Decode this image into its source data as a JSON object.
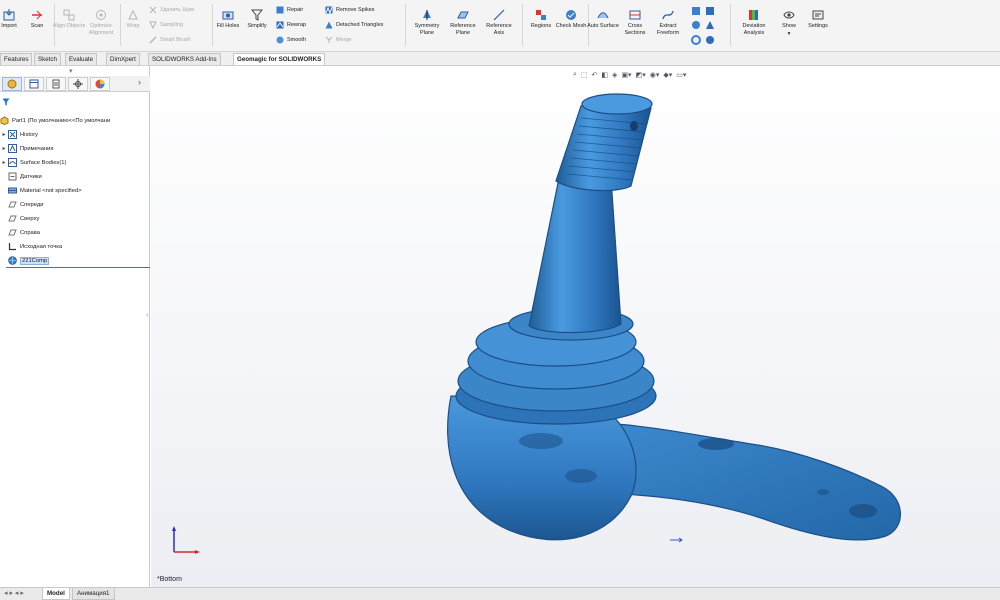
{
  "colors": {
    "model_blue": "#3a86c8",
    "model_dark": "#1f5d96",
    "accent": "#1e73d6"
  },
  "ribbon": {
    "tools": [
      {
        "id": "import",
        "label": "Import",
        "icon": "import-icon"
      },
      {
        "id": "scan",
        "label": "Scan",
        "icon": "scan-icon"
      },
      {
        "id": "align_objects",
        "label": "Align Objects",
        "icon": "align-icon"
      },
      {
        "id": "optimize_alignment",
        "label": "Optimize Alignment",
        "icon": "optimize-icon"
      },
      {
        "id": "wrap",
        "label": "Wrap",
        "icon": "wrap-icon"
      },
      {
        "id": "fill_holes",
        "label": "Fill Holes",
        "icon": "fill-holes-icon"
      },
      {
        "id": "simplify",
        "label": "Simplify",
        "icon": "funnel-icon"
      },
      {
        "id": "symmetry_plane",
        "label": "Symmetry Plane",
        "icon": "symmetry-plane-icon"
      },
      {
        "id": "reference_plane",
        "label": "Reference Plane",
        "icon": "reference-plane-icon"
      },
      {
        "id": "reference_axis",
        "label": "Reference Axis",
        "icon": "reference-axis-icon"
      },
      {
        "id": "regions",
        "label": "Regions",
        "icon": "regions-icon"
      },
      {
        "id": "check_mesh",
        "label": "Check Mesh",
        "icon": "check-mesh-icon"
      },
      {
        "id": "auto_surface",
        "label": "Auto Surface",
        "icon": "auto-surface-icon"
      },
      {
        "id": "cross_sections",
        "label": "Cross Sections",
        "icon": "cross-sections-icon"
      },
      {
        "id": "extract_freeform",
        "label": "Extract Freeform",
        "icon": "freeform-icon"
      },
      {
        "id": "deviation_analysis",
        "label": "Deviation Analysis",
        "icon": "deviation-icon"
      },
      {
        "id": "show",
        "label": "Show",
        "icon": "eye-icon"
      },
      {
        "id": "settings",
        "label": "Settings",
        "icon": "settings-icon"
      }
    ],
    "small_tools": {
      "delete_noise": "Удалить Шум",
      "sampling": "Sampling",
      "smart_brush": "Smart Brush",
      "repair": "Repair",
      "rewrap": "Rewrap",
      "smooth": "Smooth",
      "remove_spikes": "Remove Spikes",
      "detached_triangles": "Detached Triangles",
      "merge": "Merge"
    }
  },
  "command_tabs": [
    "Features",
    "Sketch",
    "Evaluate",
    "DimXpert",
    "SOLIDWORKS Add-Ins",
    "Geomagic for SOLIDWORKS"
  ],
  "feature_tree": {
    "root": "Part1 (По умолчанию<<По умолчани",
    "items": [
      {
        "label": "History",
        "expand": "▸",
        "icon": "history-icon"
      },
      {
        "label": "Примечания",
        "expand": "▸",
        "icon": "annotations-icon"
      },
      {
        "label": "Surface Bodies(1)",
        "expand": "▸",
        "icon": "surface-bodies-icon"
      },
      {
        "label": "Датчики",
        "expand": "",
        "icon": "sensors-icon"
      },
      {
        "label": "Material <not specified>",
        "expand": "",
        "icon": "material-icon"
      },
      {
        "label": "Спереди",
        "expand": "",
        "icon": "plane-icon"
      },
      {
        "label": "Сверху",
        "expand": "",
        "icon": "plane-icon"
      },
      {
        "label": "Справа",
        "expand": "",
        "icon": "plane-icon"
      },
      {
        "label": "Исходная точка",
        "expand": "",
        "icon": "origin-icon"
      },
      {
        "label": "221Comp",
        "expand": "",
        "icon": "mesh-icon"
      }
    ]
  },
  "viewport": {
    "view_label": "*Bottom"
  },
  "bottom_tabs": [
    "Model",
    "Анимация1"
  ]
}
